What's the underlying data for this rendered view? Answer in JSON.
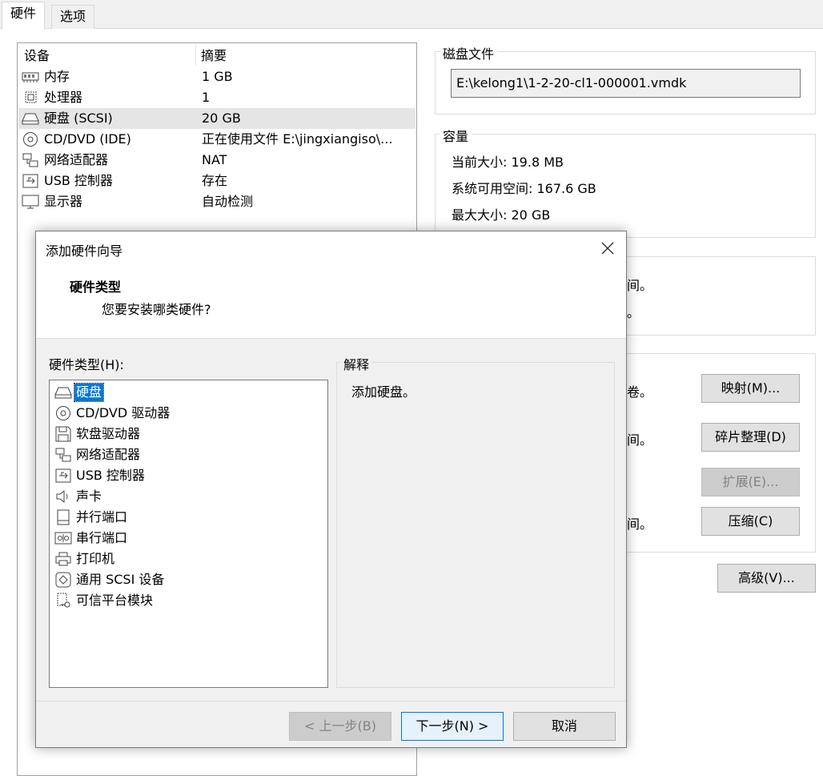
{
  "tabs": [
    {
      "label": "硬件",
      "active": true
    },
    {
      "label": "选项",
      "active": false
    }
  ],
  "device_list": {
    "headers": {
      "device": "设备",
      "summary": "摘要"
    },
    "rows": [
      {
        "icon": "memory-icon",
        "name": "内存",
        "summary": "1 GB"
      },
      {
        "icon": "processor-icon",
        "name": "处理器",
        "summary": "1"
      },
      {
        "icon": "hard-disk-icon",
        "name": "硬盘 (SCSI)",
        "summary": "20 GB",
        "selected": true
      },
      {
        "icon": "cd-dvd-icon",
        "name": "CD/DVD (IDE)",
        "summary": "正在使用文件 E:\\jingxiangiso\\..."
      },
      {
        "icon": "network-adapter-icon",
        "name": "网络适配器",
        "summary": "NAT"
      },
      {
        "icon": "usb-controller-icon",
        "name": "USB 控制器",
        "summary": "存在"
      },
      {
        "icon": "display-icon",
        "name": "显示器",
        "summary": "自动检测"
      }
    ]
  },
  "disk_file": {
    "legend": "磁盘文件",
    "path": "E:\\kelong1\\1-2-20-cl1-000001.vmdk"
  },
  "capacity": {
    "legend": "容量",
    "current_label": "当前大小:",
    "current_value": "19.8 MB",
    "free_label": "系统可用空间:",
    "free_value": "167.6 GB",
    "max_label": "最大大小:",
    "max_value": "20 GB"
  },
  "partial_text": {
    "t1": "间。",
    "t2": "。",
    "t3": "卷。",
    "t4": "间。",
    "t5": "间。"
  },
  "buttons": {
    "map": "映射(M)...",
    "defrag": "碎片整理(D)",
    "expand": "扩展(E)...",
    "compact": "压缩(C)",
    "advanced": "高级(V)..."
  },
  "dialog": {
    "title": "添加硬件向导",
    "header_title": "硬件类型",
    "header_subtitle": "您要安装哪类硬件?",
    "list_label": "硬件类型(H):",
    "hardware_types": [
      {
        "icon": "hard-disk-icon",
        "label": "硬盘",
        "selected": true
      },
      {
        "icon": "cd-dvd-icon",
        "label": "CD/DVD 驱动器"
      },
      {
        "icon": "floppy-icon",
        "label": "软盘驱动器"
      },
      {
        "icon": "network-adapter-icon",
        "label": "网络适配器"
      },
      {
        "icon": "usb-controller-icon",
        "label": "USB 控制器"
      },
      {
        "icon": "sound-card-icon",
        "label": "声卡"
      },
      {
        "icon": "parallel-port-icon",
        "label": "并行端口"
      },
      {
        "icon": "serial-port-icon",
        "label": "串行端口"
      },
      {
        "icon": "printer-icon",
        "label": "打印机"
      },
      {
        "icon": "scsi-device-icon",
        "label": "通用 SCSI 设备"
      },
      {
        "icon": "tpm-icon",
        "label": "可信平台模块"
      }
    ],
    "explain_legend": "解释",
    "explain_text": "添加硬盘。",
    "back": "< 上一步(B)",
    "next": "下一步(N) >",
    "cancel": "取消"
  }
}
